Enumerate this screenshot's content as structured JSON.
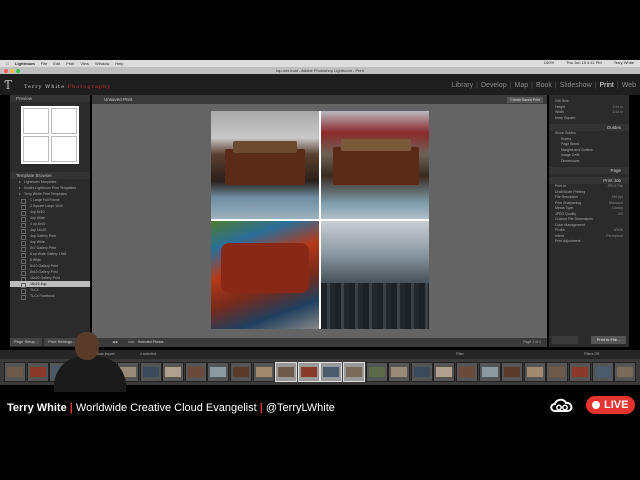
{
  "menubar": {
    "app": "Lightroom",
    "items": [
      "File",
      "Edit",
      "Print",
      "View",
      "Window",
      "Help"
    ],
    "battery": "100%",
    "clock": "Thu Jun 15 4:11 PM",
    "user": "Terry White"
  },
  "window": {
    "title": "lap-mix.lrcat - Adobe Photoshop Lightroom - Print"
  },
  "identity": {
    "brand_a": "Terry White ",
    "brand_b": "Photography"
  },
  "modules": {
    "library": "Library",
    "develop": "Develop",
    "map": "Map",
    "book": "Book",
    "slideshow": "Slideshow",
    "print": "Print",
    "web": "Web"
  },
  "left_panel": {
    "preview_label": "Preview",
    "template_browser_label": "Template Browser",
    "templates": [
      {
        "label": "Lightroom Templates",
        "folder": true
      },
      {
        "label": "Scott's Lightroom Print Templates",
        "folder": true
      },
      {
        "label": "Terry White Print Templates",
        "folder": true
      },
      {
        "label": "1 Large Full Frame"
      },
      {
        "label": "2 Square Large 16x9"
      },
      {
        "label": "4up 8x10"
      },
      {
        "label": "4up Wide"
      },
      {
        "label": "4 up 8x10"
      },
      {
        "label": "4up 16x20"
      },
      {
        "label": "4up Gallery Print"
      },
      {
        "label": "4up Wide"
      },
      {
        "label": "5x7 Gallery Print"
      },
      {
        "label": "8 up Wide Gallery 19x8"
      },
      {
        "label": "8 Wide"
      },
      {
        "label": "8x10 Gallery Print"
      },
      {
        "label": "8x10 Gallery Print"
      },
      {
        "label": "16x20 Gallery Print"
      },
      {
        "label": "16x16 4up",
        "selected": true
      },
      {
        "label": "TLC4"
      },
      {
        "label": "TLC4 Facebook"
      }
    ],
    "page_setup": "Page Setup...",
    "print_settings": "Print Settings..."
  },
  "center": {
    "title": "Unsaved Print",
    "create_saved_print": "Create Saved Print",
    "use_label": "Use:",
    "use_value": "Selected Photos",
    "page_info": "Page 1 of 1"
  },
  "right_panel": {
    "cell_size": [
      {
        "label": "Cell Size",
        "value": ""
      },
      {
        "label": "Height",
        "value": "3.94 in"
      },
      {
        "label": "Width",
        "value": "3.94 in"
      },
      {
        "label": "Keep Square",
        "value": ""
      }
    ],
    "guides_label": "Guides",
    "guides": [
      "Show Guides",
      "Rulers",
      "Page Bleed",
      "Margins and Gutters",
      "Image Cells",
      "Dimensions"
    ],
    "page_label": "Page",
    "print_job_label": "Print Job",
    "print_job": [
      {
        "label": "Print to:",
        "value": "JPEG File"
      },
      {
        "label": "Draft Mode Printing",
        "value": ""
      },
      {
        "label": "File Resolution",
        "value": "240 ppi"
      },
      {
        "label": "Print Sharpening",
        "value": "Standard"
      },
      {
        "label": "Media Type",
        "value": "Glossy"
      },
      {
        "label": "JPEG Quality",
        "value": "100"
      },
      {
        "label": "Custom File Dimensions",
        "value": ""
      },
      {
        "label": "Color Management",
        "value": ""
      },
      {
        "label": "Profile",
        "value": "sRGB"
      },
      {
        "label": "Intent",
        "value": "Perceptual"
      },
      {
        "label": "Print Adjustment",
        "value": ""
      }
    ],
    "print_to_file": "Print to File..."
  },
  "filmbar": {
    "folder": "Previous Import",
    "selection": "4 selected",
    "filter_label": "Filter",
    "filter_value": "Filters Off"
  },
  "caption": {
    "name": "Terry White",
    "title": "Worldwide Creative Cloud Evangelist",
    "handle": "@TerryLWhite",
    "live": "LIVE"
  },
  "colors": {
    "accent_red": "#e3342f",
    "lr_bg": "#2b2b2b",
    "canvas": "#646464"
  }
}
